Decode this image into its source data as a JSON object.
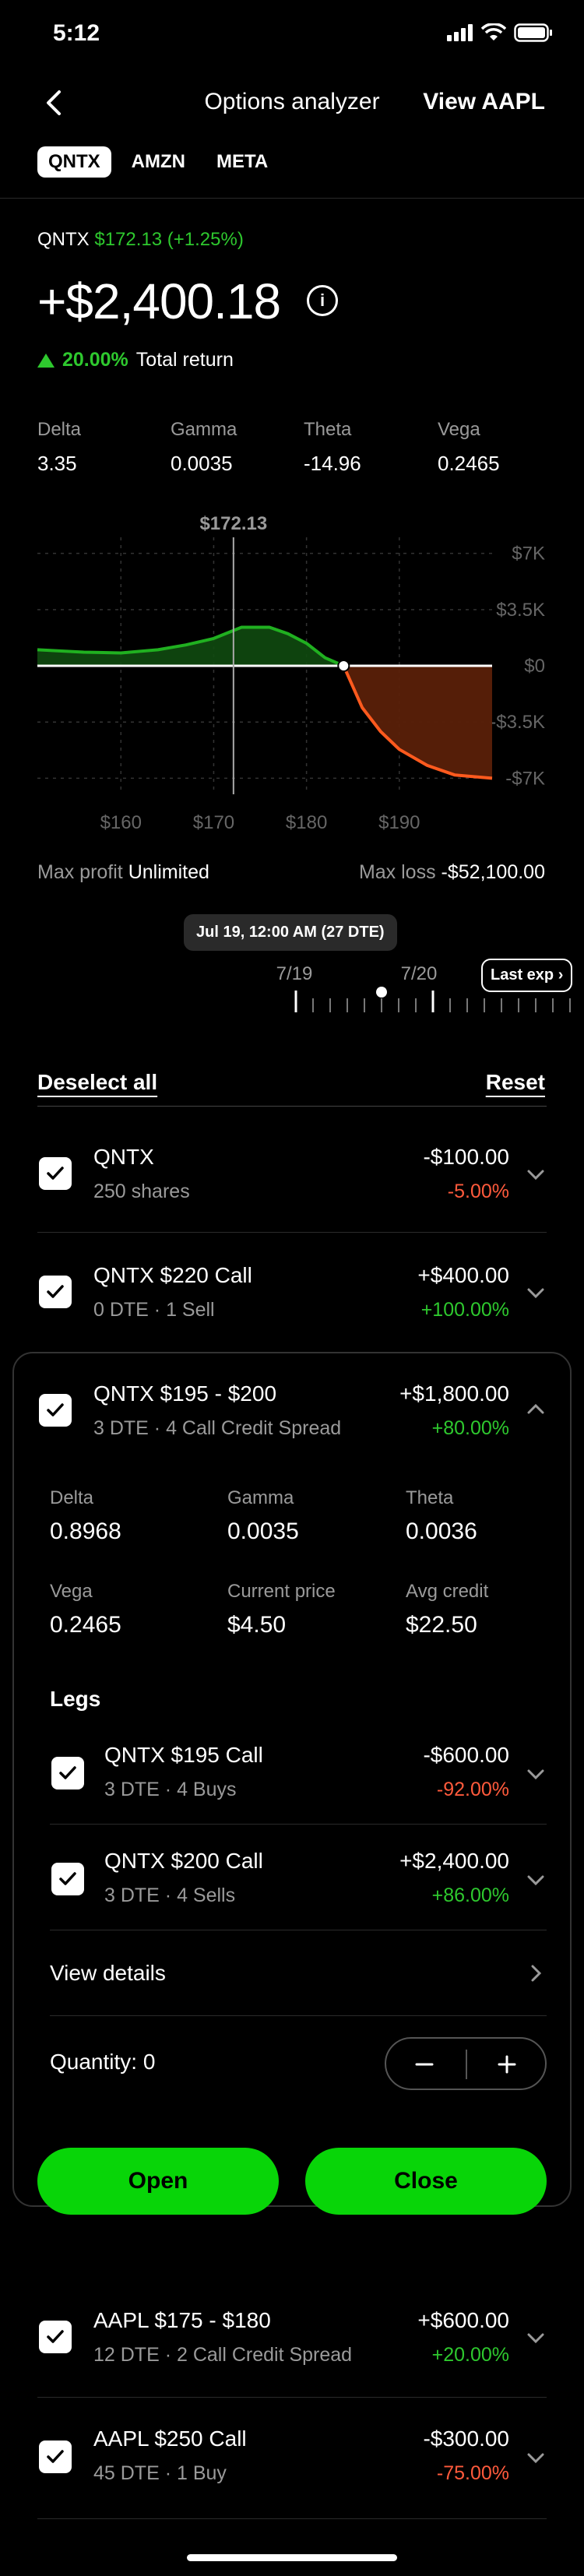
{
  "status": {
    "time": "5:12"
  },
  "nav": {
    "title": "Options analyzer",
    "right_link": "View AAPL"
  },
  "tabs": [
    {
      "label": "QNTX",
      "active": true
    },
    {
      "label": "AMZN",
      "active": false
    },
    {
      "label": "META",
      "active": false
    }
  ],
  "summary": {
    "ticker": "QNTX",
    "price_change": "$172.13 (+1.25%)",
    "total_value": "+$2,400.18",
    "return_pct": "20.00%",
    "return_label": "Total return"
  },
  "greeks": [
    {
      "label": "Delta",
      "value": "3.35"
    },
    {
      "label": "Gamma",
      "value": "0.0035"
    },
    {
      "label": "Theta",
      "value": "-14.96"
    },
    {
      "label": "Vega",
      "value": "0.2465"
    }
  ],
  "chart_data": {
    "type": "area",
    "current_price_label": "$172.13",
    "current_price": 172.13,
    "x_ticks": [
      "$160",
      "$170",
      "$180",
      "$190"
    ],
    "x_tick_values": [
      160,
      170,
      180,
      190
    ],
    "y_ticks": [
      "$7K",
      "$3.5K",
      "$0",
      "-$3.5K",
      "-$7K"
    ],
    "y_tick_values": [
      7000,
      3500,
      0,
      -3500,
      -7000
    ],
    "xlim": [
      151,
      200
    ],
    "ylim": [
      -8000,
      8000
    ],
    "breakeven": 184,
    "x": [
      151,
      156,
      160,
      164,
      167,
      170,
      173,
      176,
      178,
      180,
      182,
      184,
      186,
      188,
      190,
      193,
      196,
      200
    ],
    "y": [
      1000,
      850,
      800,
      1000,
      1300,
      1700,
      2400,
      2400,
      2000,
      1400,
      500,
      0,
      -2600,
      -4100,
      -5200,
      -6200,
      -6800,
      -7000
    ],
    "colors": {
      "profit": "#20b020",
      "loss": "#ff5a1e"
    },
    "grid": true
  },
  "limits": {
    "max_profit_label": "Max profit",
    "max_profit": "Unlimited",
    "max_loss_label": "Max loss",
    "max_loss": "-$52,100.00"
  },
  "timeline": {
    "tooltip": "Jul 19, 12:00 AM (27 DTE)",
    "dates": [
      "7/19",
      "7/20"
    ],
    "last_exp": "Last exp"
  },
  "actions": {
    "deselect_all": "Deselect all",
    "reset": "Reset"
  },
  "positions": [
    {
      "title": "QNTX",
      "sub": "250 shares",
      "value": "-$100.00",
      "pct": "-5.00%",
      "pct_color": "red"
    },
    {
      "title": "QNTX $220 Call",
      "sub": "0 DTE · 1 Sell",
      "value": "+$400.00",
      "pct": "+100.00%",
      "pct_color": "green"
    },
    {
      "title": "QNTX $195 - $200",
      "sub": "3 DTE · 4 Call Credit Spread",
      "value": "+$1,800.00",
      "pct": "+80.00%",
      "pct_color": "green"
    },
    {
      "title": "AAPL $175 - $180",
      "sub": "12 DTE · 2 Call Credit Spread",
      "value": "+$600.00",
      "pct": "+20.00%",
      "pct_color": "green"
    },
    {
      "title": "AAPL $250 Call",
      "sub": "45 DTE · 1 Buy",
      "value": "-$300.00",
      "pct": "-75.00%",
      "pct_color": "red"
    }
  ],
  "expanded": {
    "details": [
      {
        "label": "Delta",
        "value": "0.8968"
      },
      {
        "label": "Gamma",
        "value": "0.0035"
      },
      {
        "label": "Theta",
        "value": "0.0036"
      },
      {
        "label": "Vega",
        "value": "0.2465"
      },
      {
        "label": "Current price",
        "value": "$4.50"
      },
      {
        "label": "Avg credit",
        "value": "$22.50"
      }
    ],
    "legs_title": "Legs",
    "legs": [
      {
        "title": "QNTX $195 Call",
        "sub": "3 DTE · 4 Buys",
        "value": "-$600.00",
        "pct": "-92.00%"
      },
      {
        "title": "QNTX $200 Call",
        "sub": "3 DTE · 4 Sells",
        "value": "+$2,400.00",
        "pct": "+86.00%"
      }
    ],
    "view_details": "View details",
    "quantity": "Quantity: 0",
    "open_label": "Open",
    "close_label": "Close"
  }
}
